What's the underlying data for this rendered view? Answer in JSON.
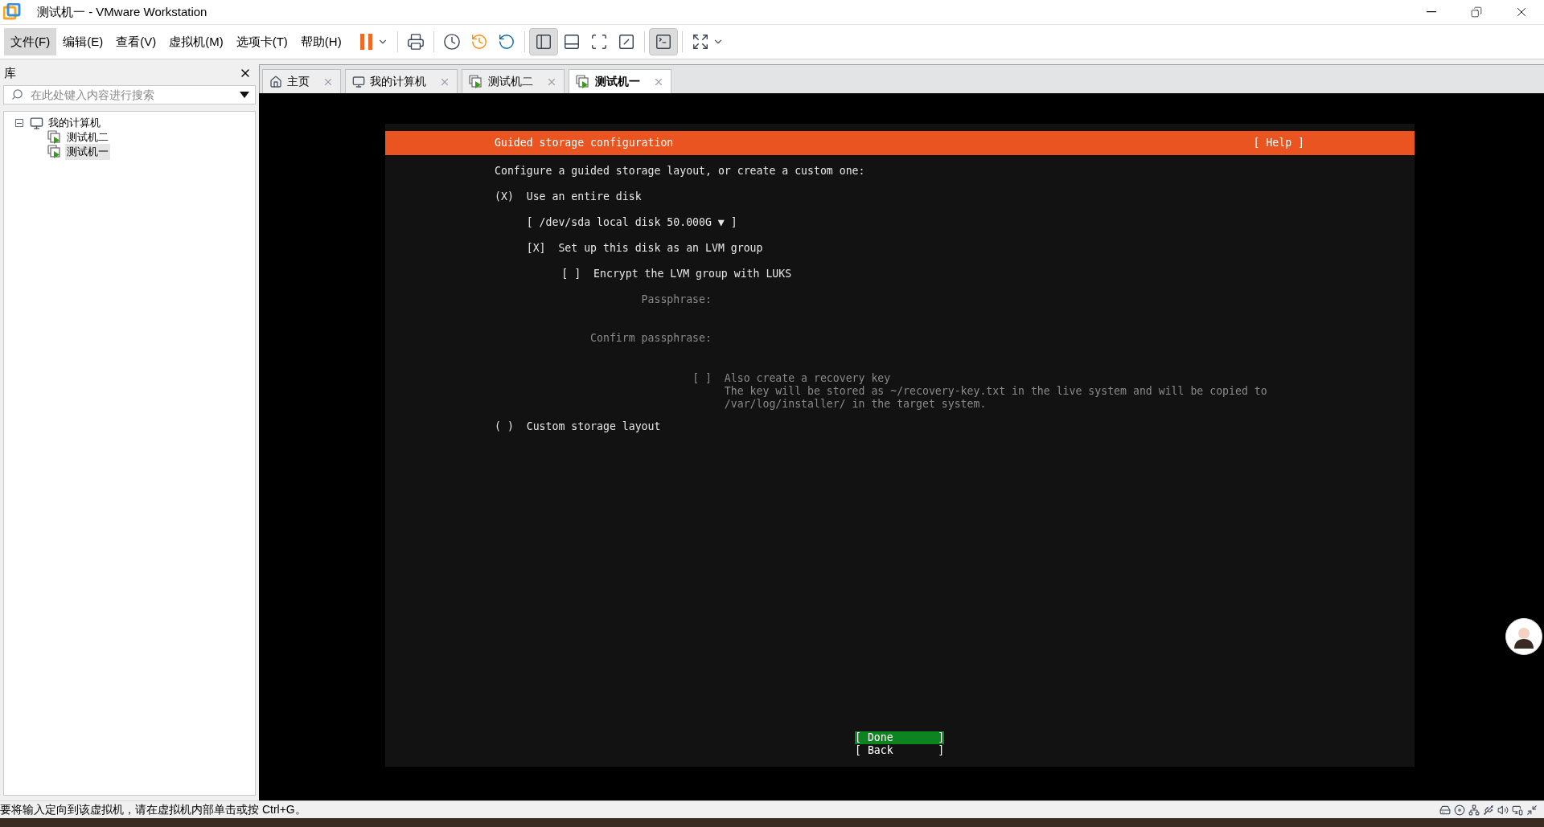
{
  "window": {
    "title": "测试机一 - VMware Workstation"
  },
  "menu": [
    {
      "label": "文件(F)",
      "selected": true
    },
    {
      "label": "编辑(E)",
      "selected": false
    },
    {
      "label": "查看(V)",
      "selected": false
    },
    {
      "label": "虚拟机(M)",
      "selected": false
    },
    {
      "label": "选项卡(T)",
      "selected": false
    },
    {
      "label": "帮助(H)",
      "selected": false
    }
  ],
  "toolbar": [
    {
      "kind": "pause",
      "selected": false
    },
    {
      "kind": "send-keys",
      "selected": false
    },
    {
      "kind": "snapshot",
      "selected": false
    },
    {
      "kind": "revert",
      "selected": false
    },
    {
      "kind": "manager",
      "selected": false
    },
    {
      "kind": "sidebar",
      "selected": true
    },
    {
      "kind": "thumbnail",
      "selected": false
    },
    {
      "kind": "fullscreen",
      "selected": false
    },
    {
      "kind": "unity",
      "selected": false
    },
    {
      "kind": "console",
      "selected": true
    },
    {
      "kind": "stretch",
      "selected": false
    }
  ],
  "library": {
    "title": "库",
    "search": {
      "placeholder": "在此处键入内容进行搜索"
    },
    "tree": [
      {
        "label": "我的计算机",
        "kind": "computer",
        "expanded": true,
        "selected": false,
        "children": [
          {
            "label": "测试机二",
            "kind": "vm",
            "selected": false
          },
          {
            "label": "测试机一",
            "kind": "vm",
            "selected": true
          }
        ]
      }
    ]
  },
  "tabs": [
    {
      "label": "主页",
      "kind": "home",
      "selected": false
    },
    {
      "label": "我的计算机",
      "kind": "computer",
      "selected": false
    },
    {
      "label": "测试机二",
      "kind": "vm",
      "selected": false
    },
    {
      "label": "测试机一",
      "kind": "vm",
      "selected": true
    }
  ],
  "installer": {
    "title": "Guided storage configuration",
    "help": "[ Help ]",
    "intro": "Configure a guided storage layout, or create a custom one:",
    "entire_disk": {
      "mark": "(X)",
      "label": "Use an entire disk"
    },
    "disk_select": "[ /dev/sda local disk 50.000G ▼ ]",
    "lvm": {
      "mark": "[X]",
      "label": "Set up this disk as an LVM group"
    },
    "encrypt": {
      "mark": "[ ]",
      "label": "Encrypt the LVM group with LUKS"
    },
    "passphrase": {
      "label": "Passphrase:",
      "disabled": true
    },
    "confirm_passphrase": {
      "label": "Confirm passphrase:",
      "disabled": true
    },
    "recovery": {
      "mark": "[ ]",
      "label": "Also create a recovery key",
      "disabled": true,
      "note": [
        "The key will be stored as ~/recovery-key.txt in the live system and will be copied to",
        "/var/log/installer/ in the target system."
      ]
    },
    "custom": {
      "mark": "( )",
      "label": "Custom storage layout"
    },
    "buttons": [
      {
        "label": "[ Done       ]",
        "selected": true
      },
      {
        "label": "[ Back       ]",
        "selected": false
      }
    ]
  },
  "status_bar": {
    "message": "要将输入定向到该虚拟机，请在虚拟机内部单击或按 Ctrl+G。"
  }
}
